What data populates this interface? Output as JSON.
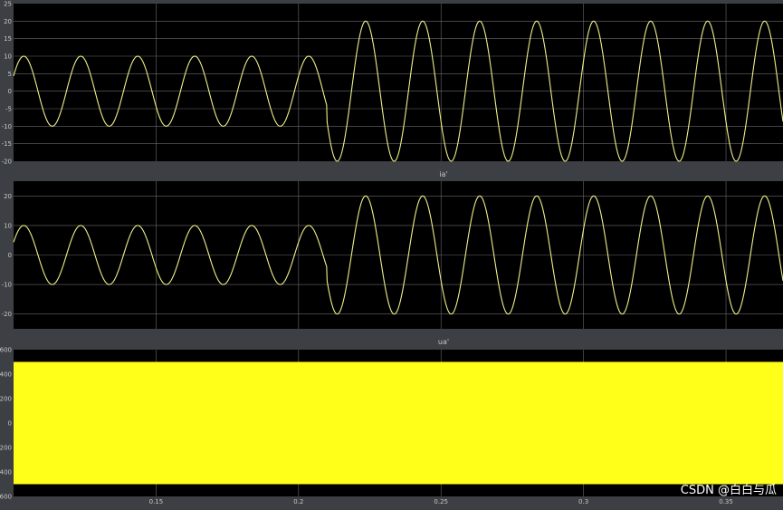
{
  "watermark": "CSDN @白白与瓜",
  "colors": {
    "figure_bg": "#3c3f44",
    "axes_bg": "#000000",
    "grid": "#6a6a6a",
    "trace": "#f0f08a",
    "fill": "#ffff1a",
    "tick_text": "#c8c8c8"
  },
  "chart_data": [
    {
      "type": "line",
      "title": "",
      "x_start": 0.1,
      "x_end": 0.37,
      "ylim": [
        -20,
        25
      ],
      "yticks": [
        "25",
        "20",
        "15",
        "10",
        "5",
        "0",
        "-5",
        "-10",
        "-15",
        "-20"
      ],
      "signal": {
        "frequency_hz": 50,
        "change_time": 0.21,
        "amplitude_before": 10,
        "amplitude_after": 20
      },
      "grid": true
    },
    {
      "type": "line",
      "title": "ia'",
      "x_start": 0.1,
      "x_end": 0.37,
      "ylim": [
        -25,
        25
      ],
      "yticks": [
        "20",
        "10",
        "0",
        "-10",
        "-20"
      ],
      "signal": {
        "frequency_hz": 50,
        "change_time": 0.21,
        "amplitude_before": 10,
        "amplitude_after": 20
      },
      "grid": true
    },
    {
      "type": "area",
      "title": "ua'",
      "x_start": 0.1,
      "x_end": 0.37,
      "ylim": [
        -600,
        600
      ],
      "yticks": [
        "600",
        "400",
        "200",
        "0",
        "-200",
        "-400",
        "-600"
      ],
      "band": [
        -500,
        500
      ],
      "xticks": [
        "0.15",
        "0.2",
        "0.25",
        "0.3",
        "0.35"
      ],
      "grid": true
    }
  ]
}
